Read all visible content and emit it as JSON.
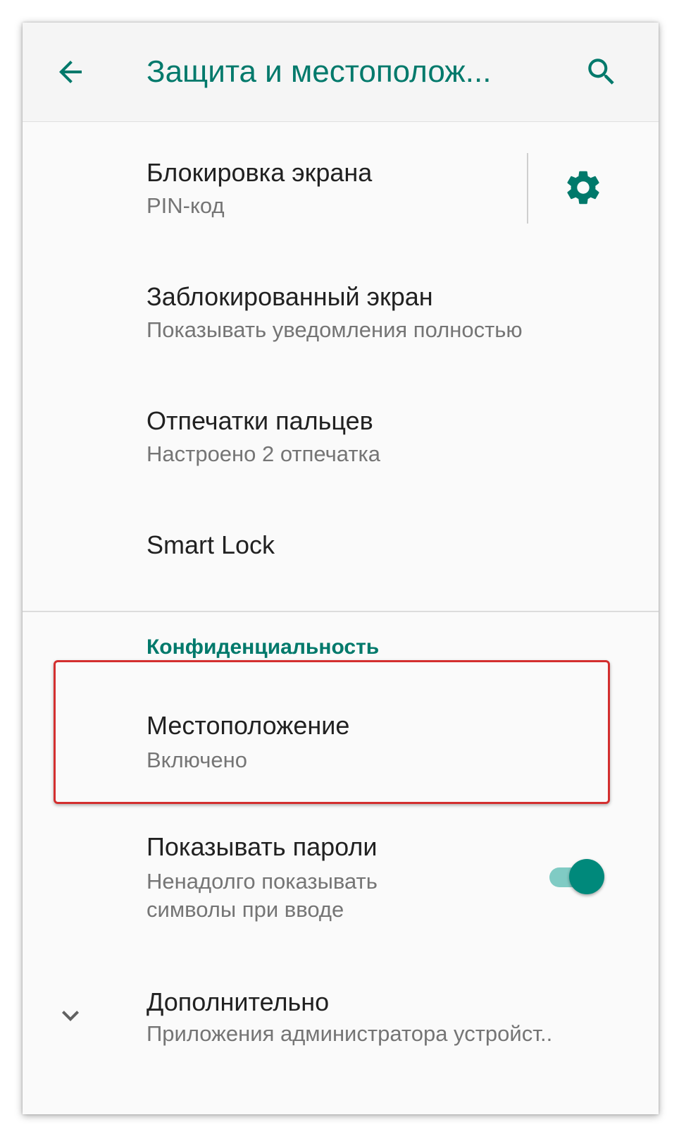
{
  "toolbar": {
    "title": "Защита и местополож...",
    "back_icon": "arrow-back-icon",
    "search_icon": "search-icon"
  },
  "items": {
    "screen_lock": {
      "title": "Блокировка экрана",
      "subtitle": "PIN-код",
      "settings_icon": "gear-icon"
    },
    "lock_screen": {
      "title": "Заблокированный экран",
      "subtitle": "Показывать уведомления полностью"
    },
    "fingerprints": {
      "title": "Отпечатки пальцев",
      "subtitle": "Настроено 2 отпечатка"
    },
    "smart_lock": {
      "title": "Smart Lock"
    }
  },
  "privacy": {
    "header": "Конфиденциальность",
    "location": {
      "title": "Местоположение",
      "subtitle": "Включено"
    },
    "show_passwords": {
      "title": "Показывать пароли",
      "subtitle_line1": "Ненадолго показывать",
      "subtitle_line2": "символы при вводе",
      "enabled": true
    },
    "advanced": {
      "title": "Дополнительно",
      "subtitle": "Приложения администратора устройст..",
      "expand_icon": "chevron-down-icon"
    }
  },
  "colors": {
    "accent": "#00796b",
    "highlight_border": "#d32f2f",
    "toggle_thumb": "#00897b",
    "toggle_track": "#80cbc4"
  }
}
